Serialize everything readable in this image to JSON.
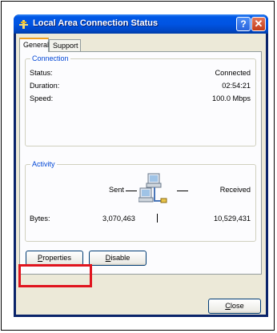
{
  "window": {
    "title": "Local Area Connection Status"
  },
  "titlebar": {
    "help_label": "?",
    "close_label": "✕"
  },
  "tabs": [
    {
      "label": "General"
    },
    {
      "label": "Support"
    }
  ],
  "connection": {
    "legend": "Connection",
    "rows": [
      {
        "label": "Status:",
        "value": "Connected"
      },
      {
        "label": "Duration:",
        "value": "02:54:21"
      },
      {
        "label": "Speed:",
        "value": "100.0 Mbps"
      }
    ]
  },
  "activity": {
    "legend": "Activity",
    "sent_label": "Sent",
    "received_label": "Received",
    "bytes_label": "Bytes:",
    "bytes_sent": "3,070,463",
    "bytes_received": "10,529,431"
  },
  "buttons": {
    "properties_first": "P",
    "properties_rest": "roperties",
    "disable_first": "D",
    "disable_rest": "isable",
    "close_first": "C",
    "close_rest": "lose"
  },
  "icons": {
    "title_icon": "network-connection-icon",
    "activity_icon": "network-computers-icon"
  },
  "colors": {
    "titlebar": "#0054e3",
    "legend_text": "#0046d5",
    "highlight": "#e0141e"
  }
}
